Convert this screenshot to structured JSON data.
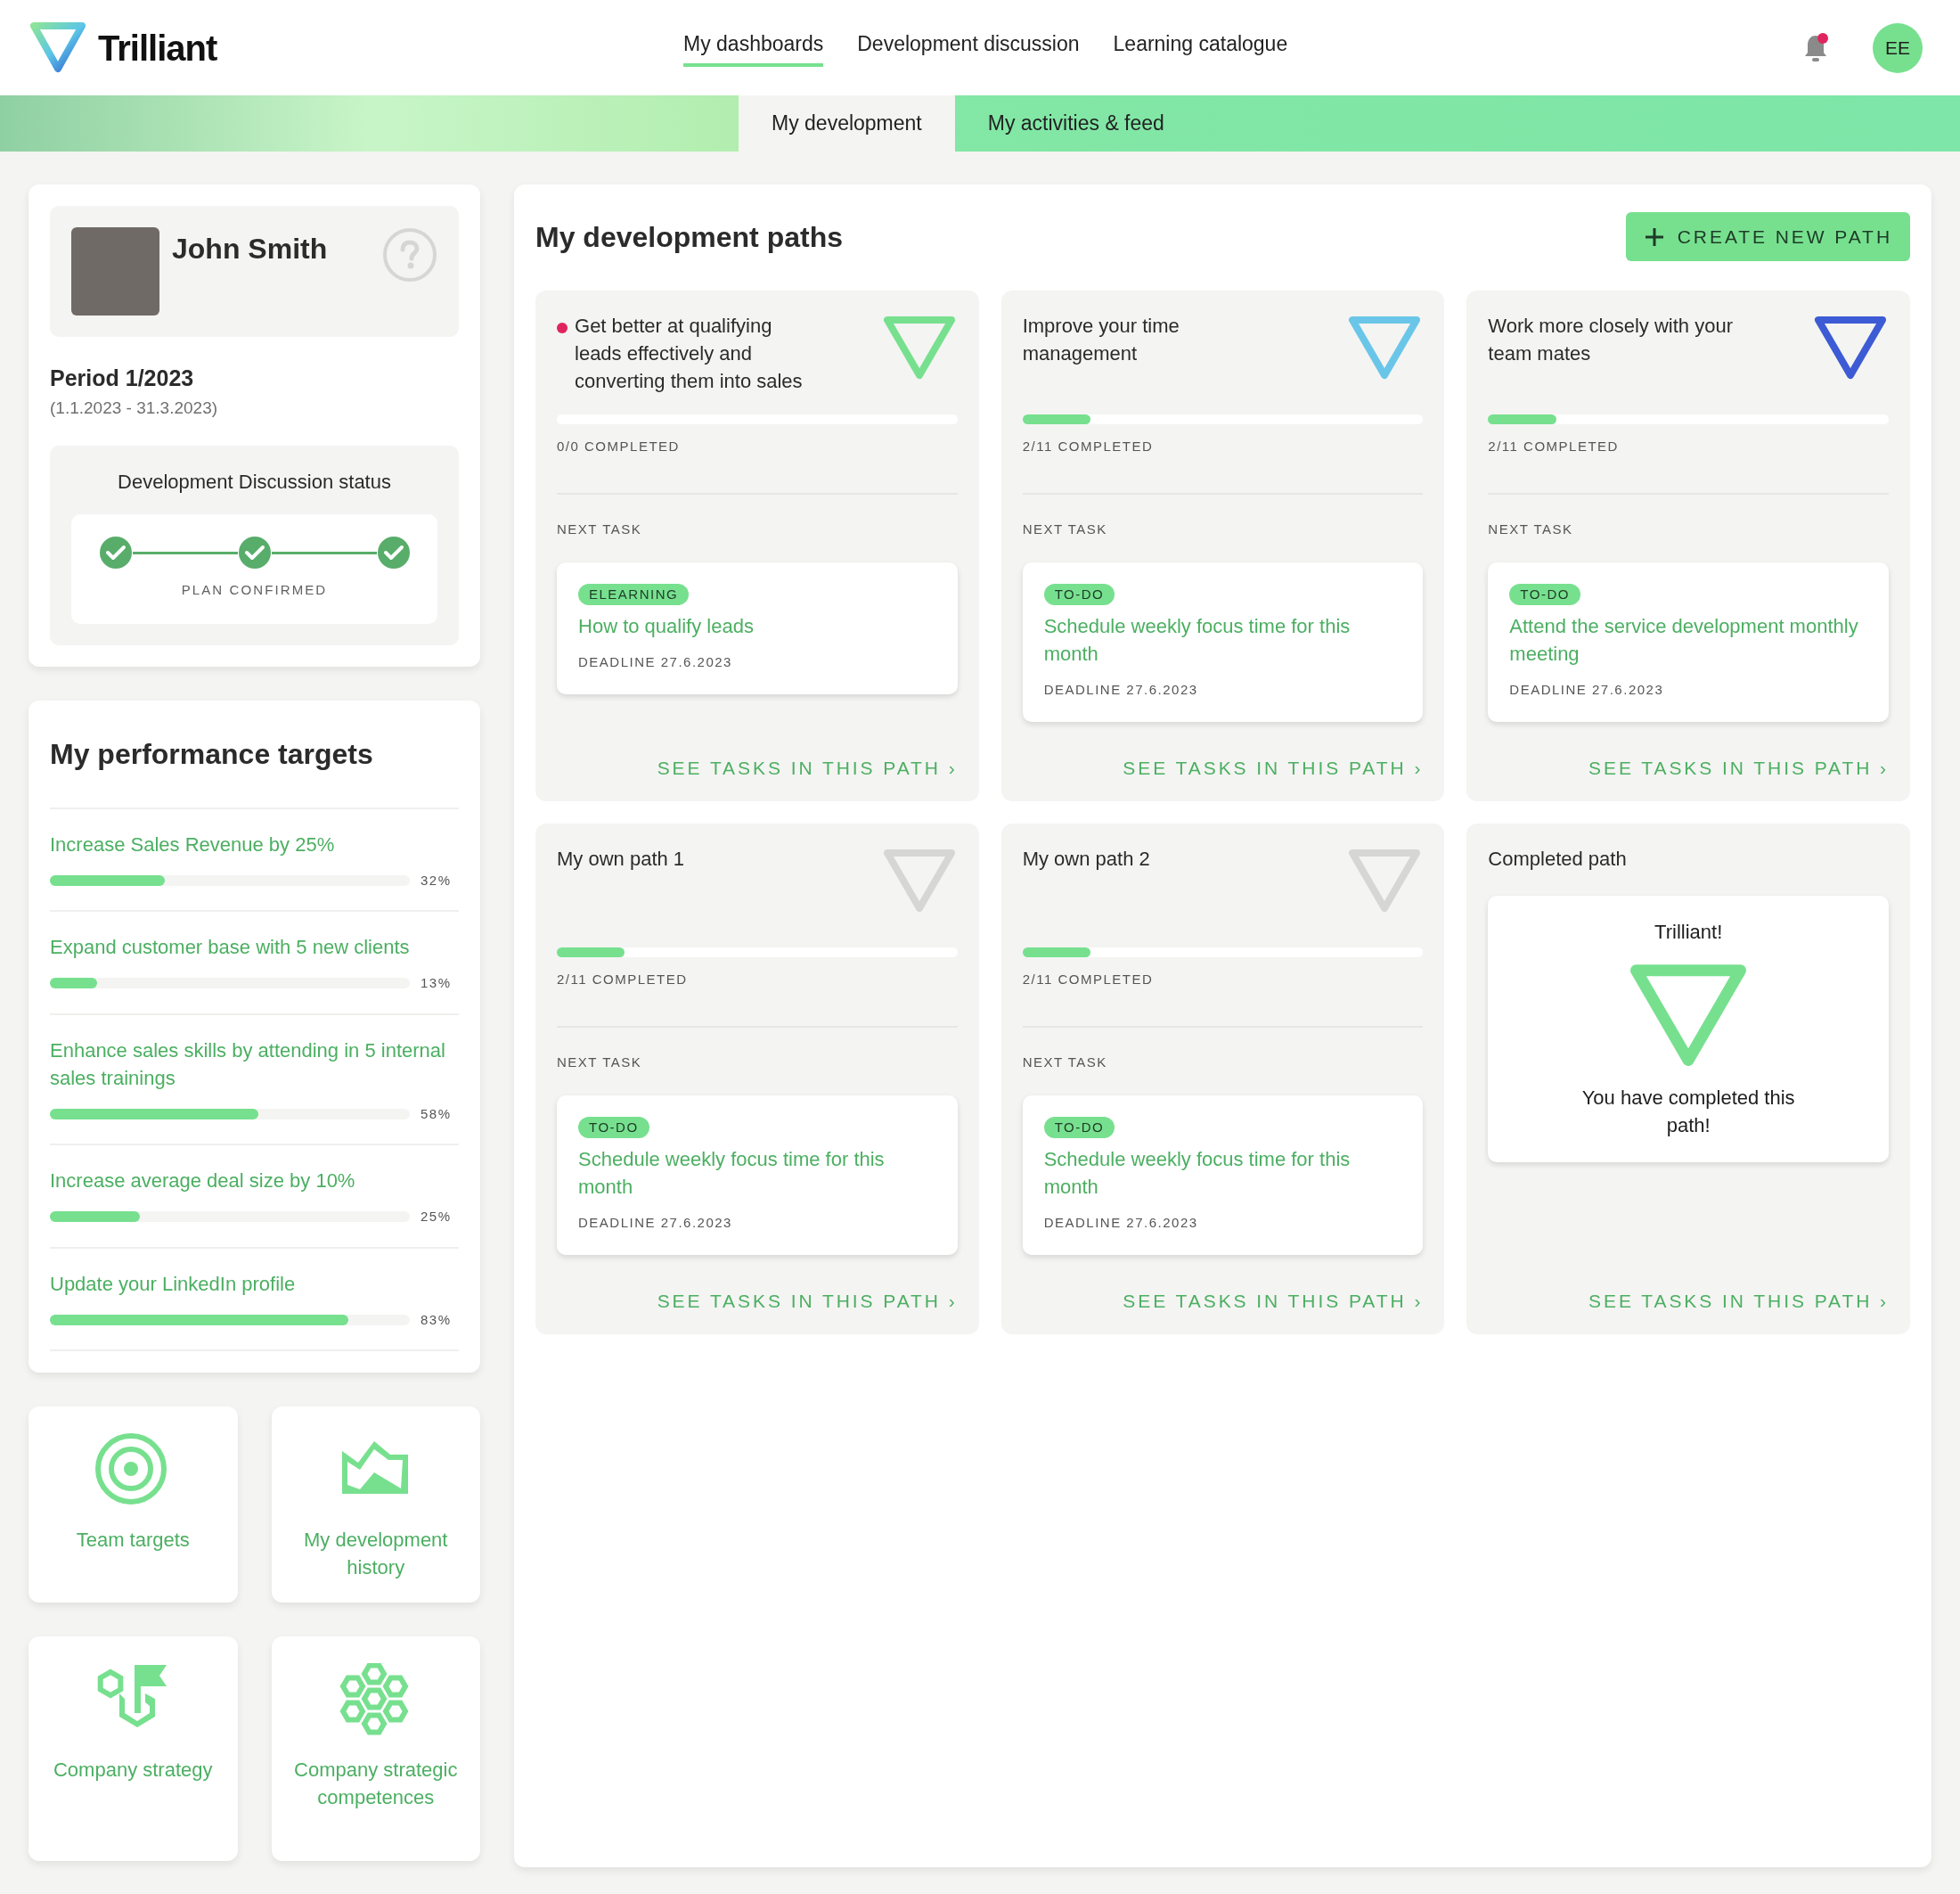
{
  "header": {
    "logo_text": "Trilliant",
    "nav": [
      {
        "label": "My dashboards",
        "selected": true
      },
      {
        "label": "Development discussion",
        "selected": false
      },
      {
        "label": "Learning catalogue",
        "selected": false
      }
    ],
    "notifications_unread": true,
    "avatar_initials": "EE"
  },
  "subtabs": [
    {
      "label": "My development",
      "selected": true
    },
    {
      "label": "My activities & feed",
      "selected": false
    }
  ],
  "profile": {
    "name": "John Smith",
    "period": "Period 1/2023",
    "period_dates": "(1.1.2023 - 31.3.2023)"
  },
  "discussion_status": {
    "title": "Development Discussion status",
    "steps": [
      {
        "done": true
      },
      {
        "done": true
      },
      {
        "done": true
      }
    ],
    "label": "PLAN CONFIRMED"
  },
  "performance_targets": {
    "title": "My performance targets",
    "items": [
      {
        "name": "Increase Sales Revenue by 25%",
        "level": 0.32,
        "reading": "32%"
      },
      {
        "name": "Expand customer base with 5 new clients",
        "level": 0.13,
        "reading": "13%"
      },
      {
        "name": "Enhance sales skills by attending in 5 internal sales trainings",
        "level": 0.58,
        "reading": "58%"
      },
      {
        "name": "Increase average deal size by 10%",
        "level": 0.25,
        "reading": "25%"
      },
      {
        "name": "Update your LinkedIn profile",
        "level": 0.83,
        "reading": "83%"
      }
    ]
  },
  "shortcuts": [
    {
      "kind": "target",
      "label": "Team targets"
    },
    {
      "kind": "chart",
      "label": "My development history"
    },
    {
      "kind": "strategy",
      "label": "Company strategy"
    },
    {
      "kind": "honeycomb",
      "label": "Company strategic competences"
    }
  ],
  "development_paths": {
    "title": "My development paths",
    "create_button": "CREATE NEW PATH",
    "paths": [
      {
        "kind": "path",
        "title": "Get better at qualifying leads effectively and converting them into sales",
        "new": true,
        "color": "#77e08f",
        "level": 0,
        "progress": "0/0 COMPLETED",
        "next_task_label": "NEXT TASK",
        "task": {
          "type": "ELEARNING",
          "title": "How to qualify leads",
          "deadline": "DEADLINE 27.6.2023"
        },
        "link": "SEE TASKS IN THIS PATH ›"
      },
      {
        "kind": "path",
        "title": "Improve your time management",
        "new": false,
        "color": "#6ac6e8",
        "level": 0.17,
        "progress": "2/11 COMPLETED",
        "next_task_label": "NEXT TASK",
        "task": {
          "type": "TO-DO",
          "title": "Schedule weekly focus time for this month",
          "deadline": "DEADLINE 27.6.2023"
        },
        "link": "SEE TASKS IN THIS PATH ›"
      },
      {
        "kind": "path",
        "title": "Work more closely with your team mates",
        "new": false,
        "color": "#3d5bd4",
        "level": 0.17,
        "progress": "2/11 COMPLETED",
        "next_task_label": "NEXT TASK",
        "task": {
          "type": "TO-DO",
          "title": "Attend the service development monthly meeting",
          "deadline": "DEADLINE 27.6.2023"
        },
        "link": "SEE TASKS IN THIS PATH ›"
      },
      {
        "kind": "path",
        "title": "My own path 1",
        "new": false,
        "color": "#d6d6d4",
        "level": 0.17,
        "progress": "2/11 COMPLETED",
        "next_task_label": "NEXT TASK",
        "task": {
          "type": "TO-DO",
          "title": "Schedule weekly focus time for this month",
          "deadline": "DEADLINE 27.6.2023"
        },
        "link": "SEE TASKS IN THIS PATH ›"
      },
      {
        "kind": "path",
        "title": "My own path 2",
        "new": false,
        "color": "#d6d6d4",
        "level": 0.17,
        "progress": "2/11 COMPLETED",
        "next_task_label": "NEXT TASK",
        "task": {
          "type": "TO-DO",
          "title": "Schedule weekly focus time for this month",
          "deadline": "DEADLINE 27.6.2023"
        },
        "link": "SEE TASKS IN THIS PATH ›"
      },
      {
        "kind": "completed",
        "title": "Completed path",
        "heading": "Trilliant!",
        "message": "You have completed this path!",
        "color": "#77e08f",
        "link": "SEE TASKS IN THIS PATH ›"
      }
    ]
  }
}
